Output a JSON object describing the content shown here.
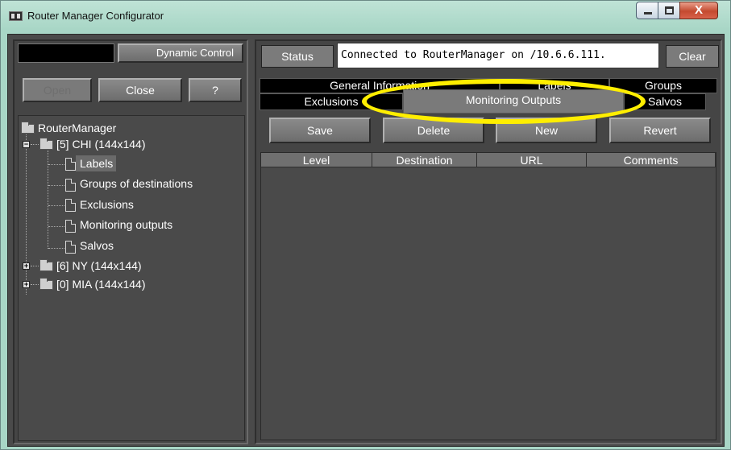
{
  "window": {
    "title": "Router Manager Configurator",
    "controls": {
      "close_glyph": "X"
    }
  },
  "left": {
    "dynamic_control_label": "Dynamic Control",
    "buttons": {
      "open": "Open",
      "close": "Close",
      "help": "?"
    },
    "tree": {
      "root": "RouterManager",
      "chi": "[5] CHI (144x144)",
      "chi_children": [
        "Labels",
        "Groups of destinations",
        "Exclusions",
        "Monitoring outputs",
        "Salvos"
      ],
      "ny": "[6] NY (144x144)",
      "mia": "[0] MIA (144x144)",
      "selected": "Labels"
    }
  },
  "right": {
    "status_label": "Status",
    "status_text": "Connected to RouterManager on /10.6.6.111.",
    "clear_label": "Clear",
    "tabs_top": [
      "General Information",
      "Labels",
      "Groups"
    ],
    "tabs_bottom": [
      "Exclusions",
      "Monitoring Outputs",
      "Salvos"
    ],
    "active_tab": "Monitoring Outputs",
    "actions": {
      "save": "Save",
      "delete": "Delete",
      "new": "New",
      "revert": "Revert"
    },
    "columns": [
      "Level",
      "Destination",
      "URL",
      "Comments"
    ]
  },
  "colors": {
    "highlight": "#ffee00",
    "panel": "#454545"
  }
}
